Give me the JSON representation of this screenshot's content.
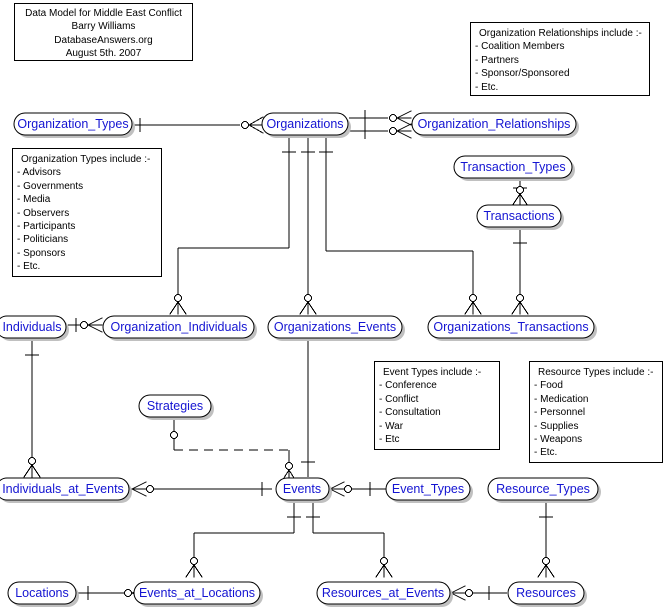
{
  "title_note": {
    "lines": [
      "Data Model for Middle East Conflict",
      "Barry Williams",
      "DatabaseAnswers.org",
      "August 5th. 2007"
    ]
  },
  "notes": [
    {
      "id": "organization-relationships-note",
      "heading": "Organization Relationships include :-",
      "items": [
        "- Coalition Members",
        "- Partners",
        "- Sponsor/Sponsored",
        "- Etc."
      ]
    },
    {
      "id": "organization-types-note",
      "heading": "Organization Types include :-",
      "items": [
        "- Advisors",
        "- Governments",
        "- Media",
        "- Observers",
        "- Participants",
        "- Politicians",
        "- Sponsors",
        "- Etc."
      ]
    },
    {
      "id": "event-types-note",
      "heading": "Event Types include :-",
      "items": [
        "- Conference",
        "- Conflict",
        "- Consultation",
        "- War",
        "- Etc"
      ]
    },
    {
      "id": "resource-types-note",
      "heading": "Resource Types include :-",
      "items": [
        "- Food",
        "- Medication",
        "- Personnel",
        "- Supplies",
        "- Weapons",
        "- Etc."
      ]
    }
  ],
  "entities": [
    {
      "id": "organization-types",
      "label": "Organization_Types"
    },
    {
      "id": "organizations",
      "label": "Organizations"
    },
    {
      "id": "organization-relationships",
      "label": "Organization_Relationships"
    },
    {
      "id": "transaction-types",
      "label": "Transaction_Types"
    },
    {
      "id": "transactions",
      "label": "Transactions"
    },
    {
      "id": "individuals",
      "label": "Individuals"
    },
    {
      "id": "organization-individuals",
      "label": "Organization_Individuals"
    },
    {
      "id": "organizations-events",
      "label": "Organizations_Events"
    },
    {
      "id": "organizations-transactions",
      "label": "Organizations_Transactions"
    },
    {
      "id": "strategies",
      "label": "Strategies"
    },
    {
      "id": "individuals-at-events",
      "label": "Individuals_at_Events"
    },
    {
      "id": "events",
      "label": "Events"
    },
    {
      "id": "event-types",
      "label": "Event_Types"
    },
    {
      "id": "resource-types",
      "label": "Resource_Types"
    },
    {
      "id": "locations",
      "label": "Locations"
    },
    {
      "id": "events-at-locations",
      "label": "Events_at_Locations"
    },
    {
      "id": "resources-at-events",
      "label": "Resources_at_Events"
    },
    {
      "id": "resources",
      "label": "Resources"
    }
  ],
  "colors": {
    "entity_text": "#1414d2",
    "line": "#000000",
    "shadow": "#c0c0c0",
    "background": "#ffffff"
  },
  "chart_data": {
    "type": "diagram",
    "notation": "crows-foot-erd",
    "relationships": [
      {
        "from": "Organization_Types",
        "to": "Organizations",
        "from_card": "one",
        "to_card": "zero-or-many"
      },
      {
        "from": "Organizations",
        "to": "Organization_Relationships",
        "from_card": "one",
        "to_card": "zero-or-many"
      },
      {
        "from": "Organizations",
        "to": "Organization_Relationships",
        "from_card": "one",
        "to_card": "zero-or-many"
      },
      {
        "from": "Organizations",
        "to": "Organization_Individuals",
        "from_card": "one",
        "to_card": "zero-or-many"
      },
      {
        "from": "Organizations",
        "to": "Organizations_Events",
        "from_card": "one",
        "to_card": "zero-or-many"
      },
      {
        "from": "Organizations",
        "to": "Organizations_Transactions",
        "from_card": "one",
        "to_card": "zero-or-many"
      },
      {
        "from": "Transaction_Types",
        "to": "Transactions",
        "from_card": "one",
        "to_card": "zero-or-many"
      },
      {
        "from": "Transactions",
        "to": "Organizations_Transactions",
        "from_card": "one",
        "to_card": "zero-or-many"
      },
      {
        "from": "Individuals",
        "to": "Organization_Individuals",
        "from_card": "one",
        "to_card": "zero-or-many"
      },
      {
        "from": "Individuals",
        "to": "Individuals_at_Events",
        "from_card": "one",
        "to_card": "zero-or-many"
      },
      {
        "from": "Organizations_Events",
        "to": "Events",
        "from_card": "zero-or-many",
        "to_card": "one"
      },
      {
        "from": "Strategies",
        "to": "Events",
        "from_card": "zero-or-many",
        "to_card": "one",
        "style": "dashed"
      },
      {
        "from": "Events",
        "to": "Individuals_at_Events",
        "from_card": "one",
        "to_card": "zero-or-many"
      },
      {
        "from": "Events",
        "to": "Event_Types",
        "from_card": "zero-or-many",
        "to_card": "one"
      },
      {
        "from": "Events",
        "to": "Events_at_Locations",
        "from_card": "one",
        "to_card": "zero-or-many"
      },
      {
        "from": "Events",
        "to": "Resources_at_Events",
        "from_card": "one",
        "to_card": "zero-or-many"
      },
      {
        "from": "Locations",
        "to": "Events_at_Locations",
        "from_card": "one",
        "to_card": "zero-or-many"
      },
      {
        "from": "Resource_Types",
        "to": "Resources",
        "from_card": "one",
        "to_card": "zero-or-many"
      },
      {
        "from": "Resources",
        "to": "Resources_at_Events",
        "from_card": "one",
        "to_card": "zero-or-many"
      }
    ]
  }
}
